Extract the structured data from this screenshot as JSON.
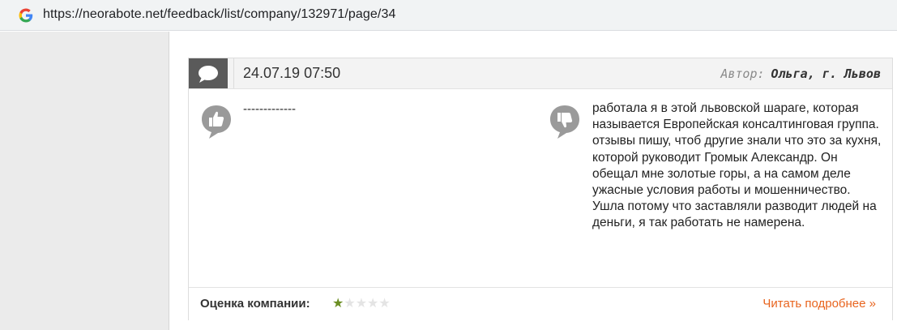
{
  "browser": {
    "url": "https://neorabote.net/feedback/list/company/132971/page/34",
    "favicon": "google-g-icon"
  },
  "review": {
    "date": "24.07.19 07:50",
    "author_label": "Автор:",
    "author_name": "Ольга,  г. Львов",
    "pros_text": "-------------",
    "cons_text": "работала я в этой львовской шараге, которая называется Европейская консалтинговая группа. отзывы пишу, чтоб другие знали что это за кухня, которой руководит Громык Александр. Он обещал мне золотые горы, а на самом деле ужасные условия работы и мошенничество. Ушла потому что заставляли разводит людей на деньги, я так работать не намерена.",
    "rating_label": "Оценка компании:",
    "rating": 1,
    "rating_max": 5,
    "read_more": "Читать подробнее »"
  },
  "colors": {
    "accent_link": "#e8641e",
    "star_filled": "#6b8e23",
    "star_empty": "#e4e4e4",
    "badge_bg": "#5a5a5a",
    "icon_gray": "#9a9a9a"
  },
  "icons": {
    "comment": "speech-bubble-icon",
    "pros": "thumbs-up-icon",
    "cons": "thumbs-down-icon"
  }
}
